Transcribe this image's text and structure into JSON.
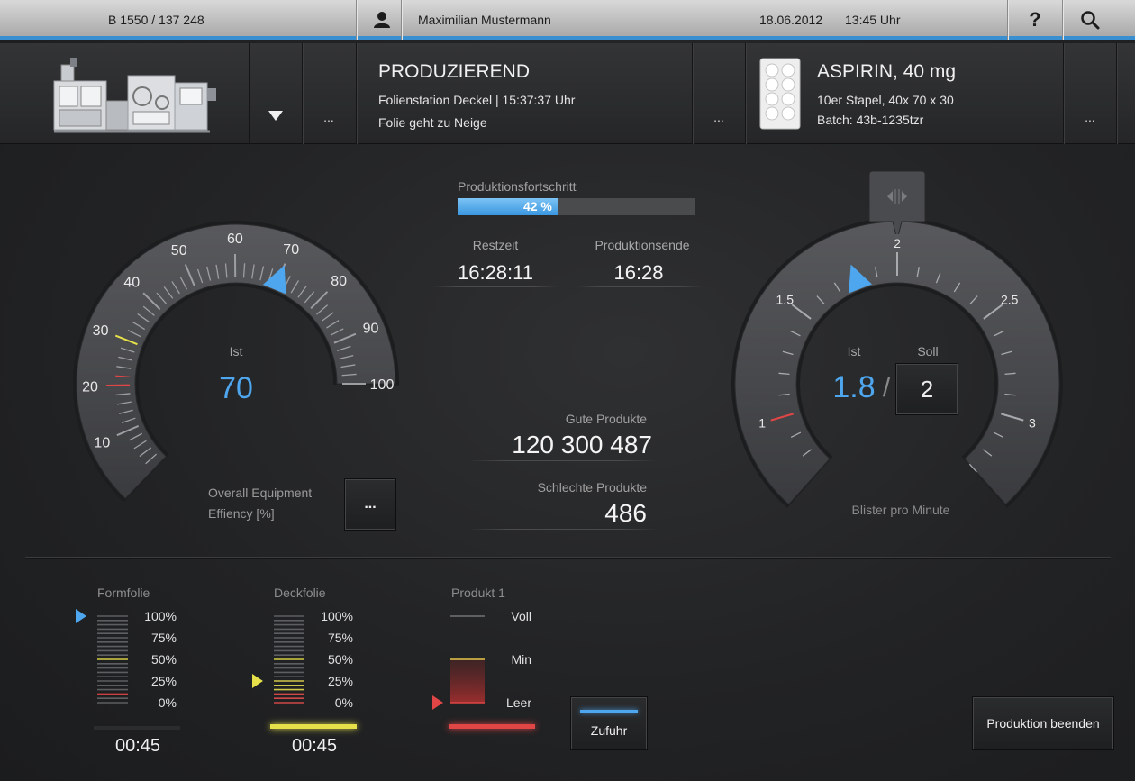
{
  "topbar": {
    "order_id": "B 1550 / 137 248",
    "user_name": "Maximilian Mustermann",
    "date": "18.06.2012",
    "time": "13:45 Uhr",
    "help_label": "?",
    "icons": [
      "user-icon",
      "help-icon",
      "search-icon"
    ]
  },
  "header": {
    "machine_dots": "...",
    "status": {
      "title": "PRODUZIEREND",
      "line1": "Folienstation Deckel | 15:37:37 Uhr",
      "line2": "Folie geht zu Neige",
      "dots": "..."
    },
    "product": {
      "title": "ASPIRIN, 40 mg",
      "line1": "10er Stapel, 40x 70 x 30",
      "line2": "Batch: 43b-1235tzr",
      "dots": "..."
    }
  },
  "oee_gauge": {
    "ticks": [
      "10",
      "20",
      "30",
      "40",
      "50",
      "60",
      "70",
      "80",
      "90",
      "100"
    ],
    "value": 70,
    "ist_label": "Ist",
    "ist_value": "70",
    "caption_line1": "Overall Equipment",
    "caption_line2": "Effiency [%]",
    "dots": "...",
    "accent": "#4ea6ee"
  },
  "production": {
    "progress_label": "Produktionsfortschritt",
    "progress_percent": 42,
    "progress_text": "42 %",
    "restzeit_label": "Restzeit",
    "restzeit_value": "16:28:11",
    "ende_label": "Produktionsende",
    "ende_value": "16:28",
    "gute_label": "Gute Produkte",
    "gute_value": "120 300 487",
    "schlechte_label": "Schlechte Produkte",
    "schlechte_value": "486"
  },
  "speed_gauge": {
    "ticks": [
      "1",
      "1.5",
      "2",
      "2.5",
      "3"
    ],
    "ist_value_num": 1.8,
    "ist_label": "Ist",
    "soll_label": "Soll",
    "ist_value": "1.8",
    "slash": "/",
    "soll_value": "2",
    "caption": "Blister pro Minute"
  },
  "supplies": {
    "formfolie": {
      "label": "Formfolie",
      "level_percent": 100,
      "time": "00:45"
    },
    "deckfolie": {
      "label": "Deckfolie",
      "level_percent": 25,
      "time": "00:45"
    },
    "scale": [
      "100%",
      "75%",
      "50%",
      "25%",
      "0%"
    ],
    "produkt": {
      "label": "Produkt 1",
      "voll": "Voll",
      "min": "Min",
      "leer": "Leer",
      "level_percent": 5
    },
    "zufuhr_label": "Zufuhr",
    "beenden_label": "Produktion beenden"
  },
  "colors": {
    "accent_blue": "#4ea6ee",
    "warn_yellow": "#e6e04a",
    "alert_red": "#e04646"
  }
}
